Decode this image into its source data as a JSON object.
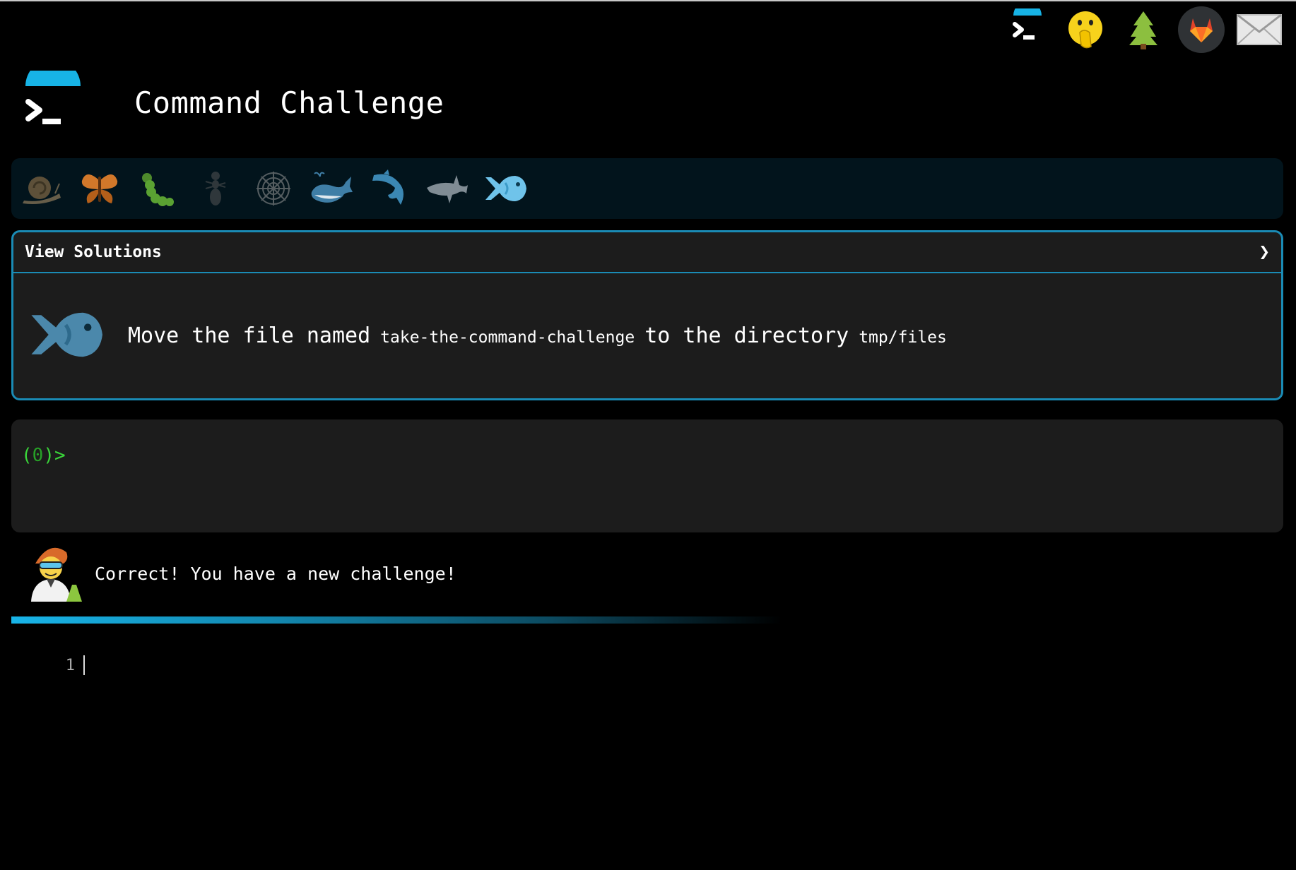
{
  "app": {
    "title": "Command Challenge"
  },
  "nav_icons": [
    "terminal-icon",
    "face-with-hand-over-mouth-icon",
    "evergreen-tree-icon",
    "gitlab-icon",
    "envelope-icon"
  ],
  "levels": [
    {
      "icon": "snail-icon",
      "state": "completed"
    },
    {
      "icon": "butterfly-icon",
      "state": "completed"
    },
    {
      "icon": "caterpillar-icon",
      "state": "completed"
    },
    {
      "icon": "ant-icon",
      "state": "completed"
    },
    {
      "icon": "spider-web-icon",
      "state": "completed"
    },
    {
      "icon": "whale-icon",
      "state": "completed"
    },
    {
      "icon": "dolphin-icon",
      "state": "completed"
    },
    {
      "icon": "shark-icon",
      "state": "completed"
    },
    {
      "icon": "fish-icon",
      "state": "current"
    }
  ],
  "challenge": {
    "toggle_label": "View Solutions",
    "toggle_icon": "chevron-right-icon",
    "level_icon": "fish-icon",
    "text_part1": "Move the file named",
    "file_name": "take-the-command-challenge",
    "text_part2": "to the directory",
    "dir_name": "tmp/files"
  },
  "terminal": {
    "prompt_open": "(",
    "prompt_count": "0",
    "prompt_close": ")>"
  },
  "feedback": {
    "avatar_icon": "scientist-icon",
    "message": "Correct! You have a new challenge!"
  },
  "editor": {
    "line_number": "1"
  },
  "colors": {
    "accent": "#1a8bb5",
    "prompt": "#3ad63a",
    "panel_bg": "#1c1c1c",
    "strip_bg": "#02141c"
  }
}
